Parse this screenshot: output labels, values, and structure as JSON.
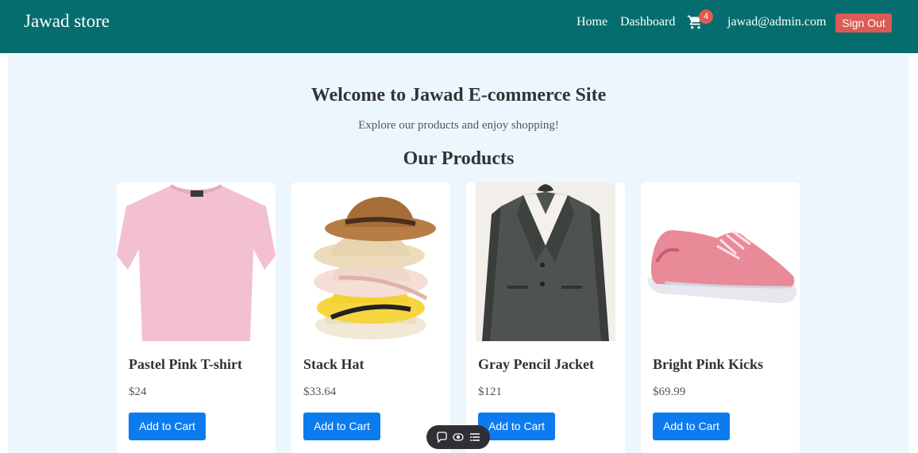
{
  "navbar": {
    "brand": "Jawad store",
    "links": {
      "home": "Home",
      "dashboard": "Dashboard"
    },
    "cart_count": "4",
    "user_email": "jawad@admin.com",
    "sign_out": "Sign Out"
  },
  "hero": {
    "welcome": "Welcome to Jawad E-commerce Site",
    "subtitle": "Explore our products and enjoy shopping!",
    "section_title": "Our Products"
  },
  "products": [
    {
      "name": "Pastel Pink T-shirt",
      "price": "$24",
      "button": "Add to Cart",
      "image": "pink-tshirt-image"
    },
    {
      "name": "Stack Hat",
      "price": "$33.64",
      "button": "Add to Cart",
      "image": "hat-stack-image"
    },
    {
      "name": "Gray Pencil Jacket",
      "price": "$121",
      "button": "Add to Cart",
      "image": "gray-jacket-image"
    },
    {
      "name": "Bright Pink Kicks",
      "price": "$69.99",
      "button": "Add to Cart",
      "image": "pink-sneaker-image"
    }
  ],
  "colors": {
    "navbar": "#056d6d",
    "page_bg": "#eef6fd",
    "primary_button": "#0d7bf0",
    "sign_out": "#dc5b54",
    "badge": "#e05a4f"
  },
  "icons": {
    "cart": "cart-icon",
    "toolbar": [
      "comment-icon",
      "eye-icon",
      "list-icon"
    ]
  }
}
